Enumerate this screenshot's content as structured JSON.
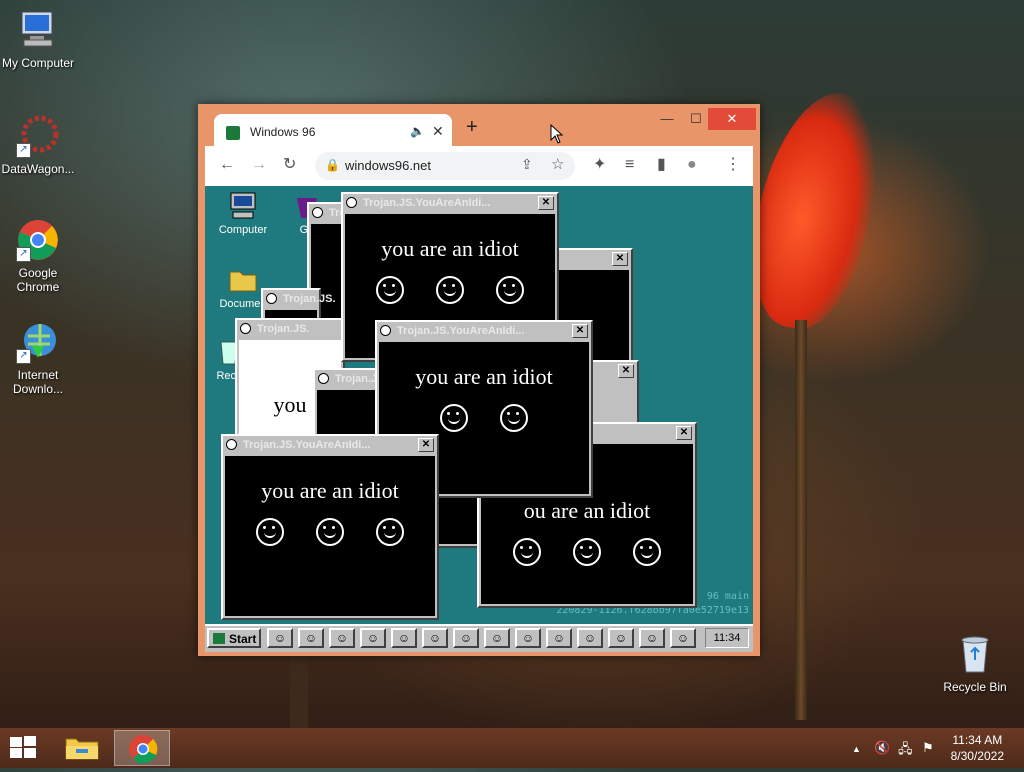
{
  "desktop": {
    "icons": [
      {
        "label": "My Computer"
      },
      {
        "label": "DataWagon..."
      },
      {
        "label": "Google Chrome"
      },
      {
        "label": "Internet Downlo..."
      },
      {
        "label": "Recycle Bin"
      }
    ]
  },
  "browser": {
    "tab_title": "Windows 96",
    "tab_mute_icon": "speaker-muted-icon",
    "tab_close": "✕",
    "new_tab": "+",
    "url": "windows96.net",
    "controls": {
      "minimize": "—",
      "maximize": "☐",
      "close": "✕"
    },
    "toolbar_icons": {
      "back": "←",
      "forward": "→",
      "reload": "↻",
      "extensions": "✦",
      "media": "≡",
      "sidepanel": "▮",
      "profile": "●",
      "menu": "⋮"
    }
  },
  "win96": {
    "icons": [
      {
        "label": "Computer"
      },
      {
        "label": "Ga"
      },
      {
        "label": "Documen"
      },
      {
        "label": "Recy"
      }
    ],
    "popup_title": "Trojan.JS.YouAreAnIdi...",
    "popup_title_short": "Trojan.JS.",
    "popup_message": "you are an idiot",
    "popup_message_partial": "you",
    "popup_message_cut": "ou are an idiot",
    "version_line1": "96 main",
    "version_line2": "220829-1126.f628bb97fa0e52719e13",
    "start_label": "Start",
    "clock": "11:34",
    "task_count": 14
  },
  "taskbar": {
    "time": "11:34 AM",
    "date": "8/30/2022",
    "tray_arrow": "▲"
  }
}
